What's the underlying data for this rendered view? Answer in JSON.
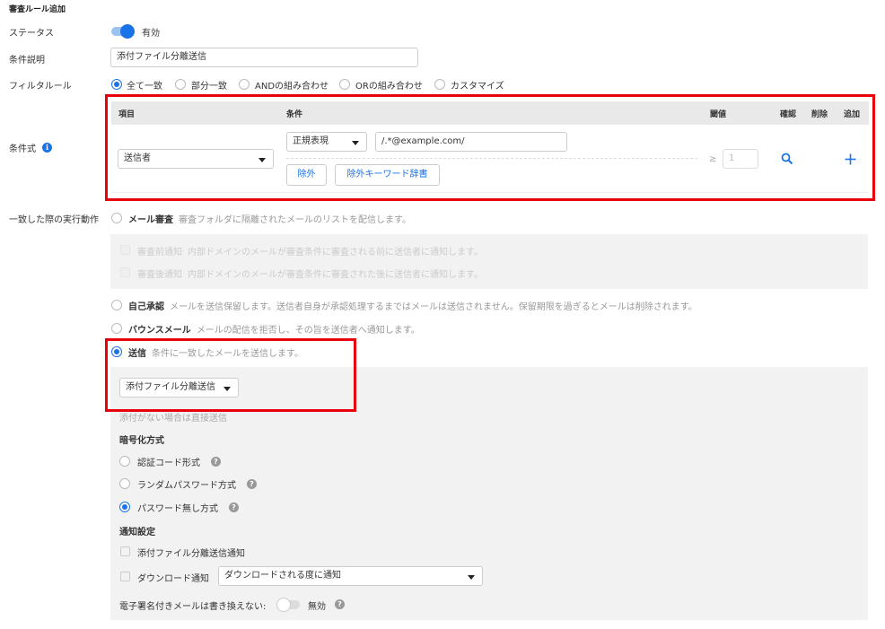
{
  "page": {
    "title": "審査ルール追加"
  },
  "status": {
    "label": "ステータス",
    "value": "有効"
  },
  "condition_desc": {
    "label": "条件説明",
    "value": "添付ファイル分離送信"
  },
  "filter": {
    "label": "フィルタルール",
    "options": [
      "全て一致",
      "部分一致",
      "ANDの組み合わせ",
      "ORの組み合わせ",
      "カスタマイズ"
    ],
    "selected": "全て一致"
  },
  "expression": {
    "label": "条件式",
    "headers": {
      "item": "項目",
      "condition": "条件",
      "threshold": "閾値",
      "confirm": "確認",
      "delete": "削除",
      "add": "追加"
    },
    "row": {
      "item": "送信者",
      "cond_type": "正規表現",
      "cond_value": "/.*@example.com/",
      "exclude_label": "除外",
      "exclude_dict_label": "除外キーワード辞書",
      "threshold_symbol": "≥",
      "threshold_value": "1"
    }
  },
  "action": {
    "label": "一致した際の実行動作",
    "options": {
      "mail_review": {
        "name": "メール審査",
        "desc": "審査フォルダに隔離されたメールのリストを配信します。"
      },
      "pre_notify": {
        "name": "審査前通知",
        "desc": "内部ドメインのメールが審査条件に審査される前に送信者に通知します。"
      },
      "post_notify": {
        "name": "審査後通知",
        "desc": "内部ドメインのメールが審査条件に審査された後に送信者に通知します。"
      },
      "self_approve": {
        "name": "自己承認",
        "desc": "メールを送信保留します。送信者自身が承認処理するまではメールは送信されません。保留期限を過ぎるとメールは削除されます。"
      },
      "bounce": {
        "name": "バウンスメール",
        "desc": "メールの配信を拒否し、その旨を送信者へ通知します。"
      },
      "send": {
        "name": "送信",
        "desc": "条件に一致したメールを送信します。"
      }
    },
    "selected": "送信"
  },
  "send_panel": {
    "select_value": "添付ファイル分離送信",
    "no_attach_note": "添付がない場合は直接送信",
    "encryption": {
      "title": "暗号化方式",
      "options": [
        "認証コード形式",
        "ランダムパスワード方式",
        "パスワード無し方式"
      ],
      "selected": "パスワード無し方式"
    },
    "notify": {
      "title": "通知設定",
      "separate_notify": "添付ファイル分離送信通知",
      "download_notify": "ダウンロード通知",
      "download_select": "ダウンロードされる度に通知"
    },
    "signature": {
      "label": "電子署名付きメールは書き換えない:",
      "value": "無効"
    }
  },
  "colors": {
    "accent": "#1a73e8",
    "highlight": "#e8000b",
    "panel": "#f2f2f2"
  },
  "icons": [
    "info-icon",
    "search-icon",
    "plus-icon",
    "help-icon",
    "caret-down-icon"
  ]
}
